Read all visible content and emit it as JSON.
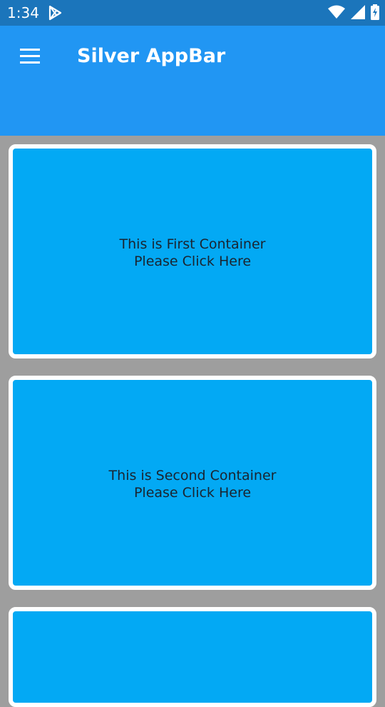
{
  "status_bar": {
    "time": "1:34"
  },
  "app_bar": {
    "title": "Silver AppBar"
  },
  "containers": [
    {
      "line1": "This is First Container",
      "line2": "Please Click Here"
    },
    {
      "line1": "This is Second Container",
      "line2": "Please Click Here"
    },
    {
      "line1": "",
      "line2": ""
    }
  ],
  "colors": {
    "status_bar": "#1b75bb",
    "app_bar": "#2196f3",
    "card": "#03a9f4",
    "background": "#9e9e9e"
  }
}
